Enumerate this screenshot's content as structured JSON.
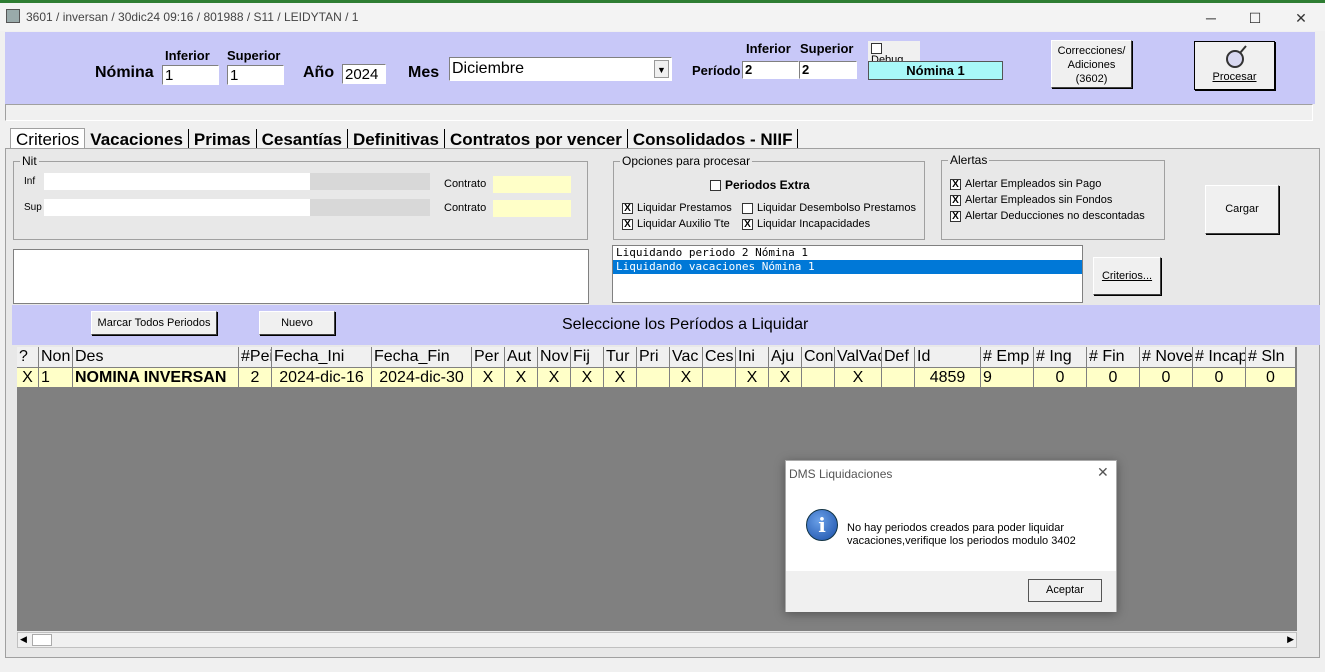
{
  "window": {
    "title": "3601 / inversan / 30dic24 09:16 / 801988 / S11 / LEIDYTAN / 1",
    "minimize": "─",
    "maximize": "☐",
    "close": "✕"
  },
  "header": {
    "nomina_label": "Nómina",
    "inferior_label": "Inferior",
    "superior_label": "Superior",
    "nomina_inf": "1",
    "nomina_sup": "1",
    "anio_label": "Año",
    "anio": "2024",
    "mes_label": "Mes",
    "mes": "Diciembre",
    "periodo_inferior_label": "Inferior",
    "periodo_superior_label": "Superior",
    "periodo_label": "Período",
    "periodo_inf": "2",
    "periodo_sup": "2",
    "debug_label": "Debug",
    "nomina_name": "Nómina 1",
    "correcciones_line1": "Correcciones/",
    "correcciones_line2": "Adiciones",
    "correcciones_line3": "(3602)",
    "procesar": "Procesar"
  },
  "tabs": [
    "Criterios",
    "Vacaciones",
    "Primas",
    "Cesantías",
    "Definitivas",
    "Contratos por vencer",
    "Consolidados - NIIF"
  ],
  "nit": {
    "group": "Nit",
    "inf": "Inf",
    "sup": "Sup",
    "contrato1": "Contrato",
    "contrato2": "Contrato"
  },
  "opciones": {
    "group": "Opciones para procesar",
    "periodos_extra": "Periodos Extra",
    "liquidar_prestamos": "Liquidar Prestamos",
    "liquidar_auxilio": "Liquidar Auxilio Tte",
    "liquidar_desembolso": "Liquidar Desembolso Prestamos",
    "liquidar_incapacidades": "Liquidar Incapacidades",
    "checked": "X"
  },
  "alertas": {
    "group": "Alertas",
    "a1": "Alertar Empleados sin Pago",
    "a2": "Alertar Empleados sin Fondos",
    "a3": "Alertar  Deducciones no descontadas"
  },
  "cargar": "Cargar",
  "criterios_btn": "Criterios...",
  "log": [
    "Liquidando periodo 2 Nómina 1",
    "Liquidando vacaciones Nómina 1"
  ],
  "selbar": {
    "marcar": "Marcar Todos Periodos",
    "nuevo": "Nuevo",
    "title": "Seleccione los Períodos a Liquidar"
  },
  "grid": {
    "headers": [
      "?",
      "Non",
      "Des",
      "#Pei",
      "Fecha_Ini",
      "Fecha_Fin",
      "Per",
      "Aut",
      "Nov",
      "Fij",
      "Tur",
      "Pri",
      "Vac",
      "Ces",
      "Ini",
      "Aju",
      "Con",
      "ValVac",
      "Def",
      "Id",
      "# Emp",
      "# Ing",
      "# Fin",
      "# Nove",
      "# Incap",
      "# Sln"
    ],
    "rows": [
      [
        "X",
        "1",
        "NOMINA INVERSAN",
        "2",
        "2024-dic-16",
        "2024-dic-30",
        "X",
        "X",
        "X",
        "X",
        "X",
        "",
        "X",
        "",
        "X",
        "X",
        "",
        "X",
        "",
        "4859",
        "9",
        "0",
        "0",
        "0",
        "0",
        "0"
      ]
    ]
  },
  "dialog": {
    "title": "DMS Liquidaciones",
    "icon": "i",
    "line1": "No hay periodos creados para poder liquidar",
    "line2": "vacaciones,verifique los periodos modulo 3402",
    "ok": "Aceptar"
  }
}
